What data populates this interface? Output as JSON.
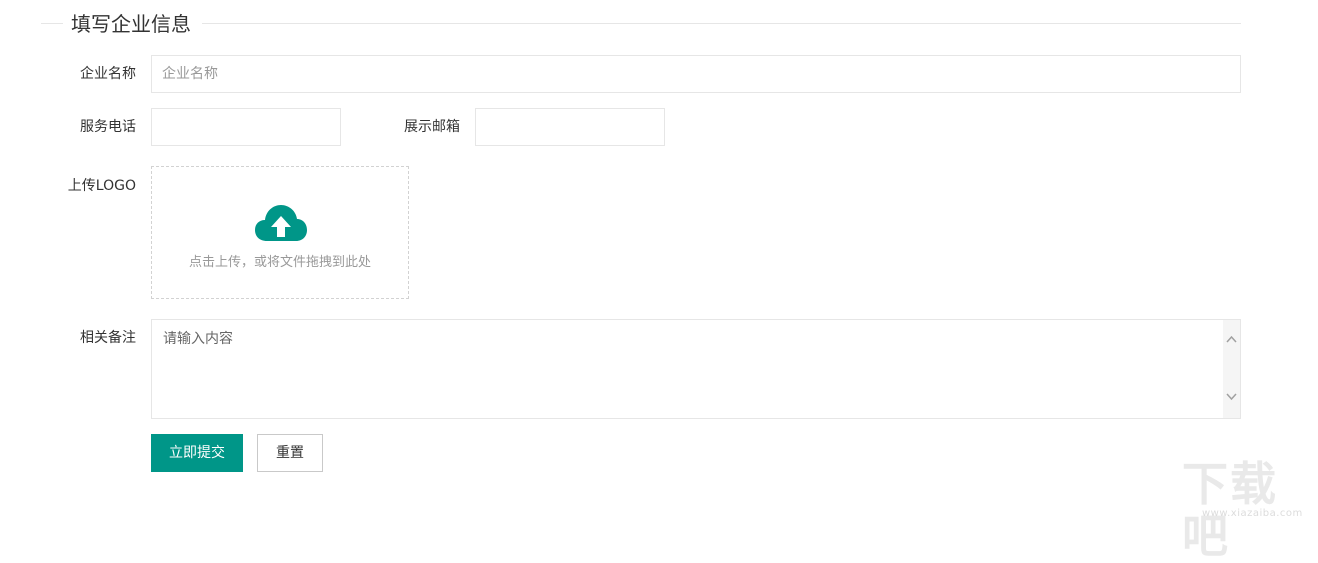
{
  "form": {
    "title": "填写企业信息",
    "company_name": {
      "label": "企业名称",
      "placeholder": "企业名称",
      "value": ""
    },
    "service_phone": {
      "label": "服务电话",
      "value": ""
    },
    "display_email": {
      "label": "展示邮箱",
      "value": ""
    },
    "logo_upload": {
      "label": "上传LOGO",
      "hint": "点击上传，或将文件拖拽到此处",
      "icon": "cloud-upload-icon",
      "icon_color": "#009688"
    },
    "remarks": {
      "label": "相关备注",
      "placeholder": "请输入内容"
    },
    "submit_label": "立即提交",
    "reset_label": "重置",
    "colors": {
      "primary": "#009688",
      "border": "#e6e6e6"
    }
  },
  "watermark": {
    "main": "下载吧",
    "url": "www.xiazaiba.com"
  }
}
